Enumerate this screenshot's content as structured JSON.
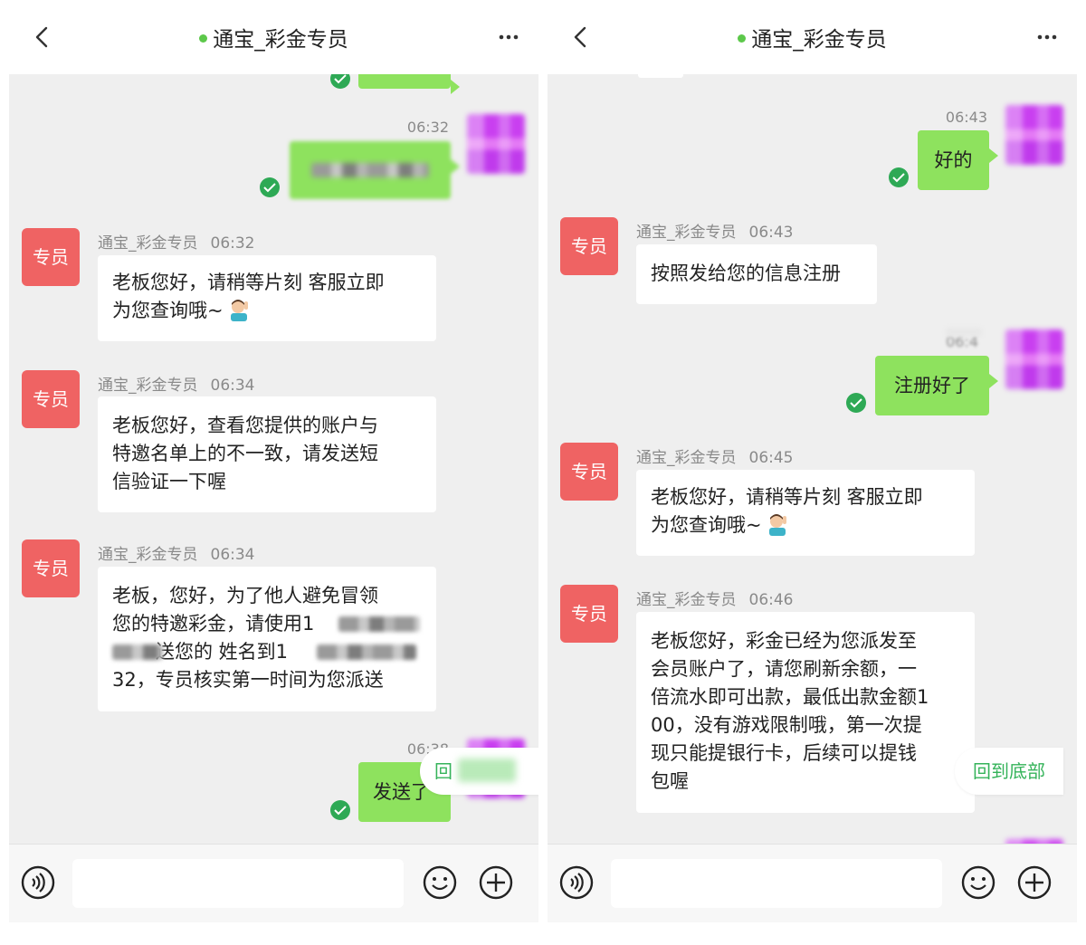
{
  "left": {
    "title": "通宝_彩金专员",
    "sent_top_time": "06:32",
    "messages": [
      {
        "avatar": "专员",
        "sender": "通宝_彩金专员",
        "time": "06:32",
        "lines": [
          "老板您好，请稍等片刻 客服立即",
          "为您查询哦~"
        ]
      },
      {
        "avatar": "专员",
        "sender": "通宝_彩金专员",
        "time": "06:34",
        "lines": [
          "老板您好，查看您提供的账户与",
          "特邀名单上的不一致，请发送短",
          "信验证一下喔"
        ]
      },
      {
        "avatar": "专员",
        "sender": "通宝_彩金专员",
        "time": "06:34",
        "lines": [
          "老板，您好，为了他人避免冒领",
          "您的特邀彩金，请使用1",
          "送您的 姓名到1",
          "32，专员核实第一时间为您派送"
        ]
      }
    ],
    "sent_bottom_time": "06:38",
    "sent_bottom_text": "发送了",
    "to_bottom_label": "回",
    "input_placeholder": ""
  },
  "right": {
    "title": "通宝_彩金专员",
    "sent1_time": "06:43",
    "sent1_text": "好的",
    "messages": [
      {
        "avatar": "专员",
        "sender": "通宝_彩金专员",
        "time": "06:43",
        "lines": [
          "按照发给您的信息注册"
        ]
      },
      {
        "avatar": "专员",
        "sender": "通宝_彩金专员",
        "time": "06:45",
        "lines": [
          "老板您好，请稍等片刻 客服立即",
          "为您查询哦~"
        ]
      },
      {
        "avatar": "专员",
        "sender": "通宝_彩金专员",
        "time": "06:46",
        "lines": [
          "老板您好，彩金已经为您派发至",
          "会员账户了，请您刷新余额，一",
          "倍流水即可出款，最低出款金额1",
          "00，没有游戏限制哦，第一次提",
          "现只能提银行卡，后续可以提钱",
          "包喔"
        ]
      }
    ],
    "sent2_time": "06:4",
    "sent2_text": "注册好了",
    "to_bottom_label": "回到底部",
    "input_placeholder": ""
  },
  "icons": {
    "back": "chevron-left-icon",
    "more": "more-dots-icon",
    "voice": "voice-icon",
    "emoji": "emoji-icon",
    "plus": "plus-icon",
    "check": "check-icon",
    "gesture_emoji": "person-tipping-hand-emoji"
  },
  "colors": {
    "avatar_red": "#ef6363",
    "outgoing_bubble": "#8ee25e",
    "online_dot": "#5cc84a",
    "sent_check": "#2ea955",
    "to_bottom_text": "#35b35a",
    "chat_background": "#efefef"
  }
}
